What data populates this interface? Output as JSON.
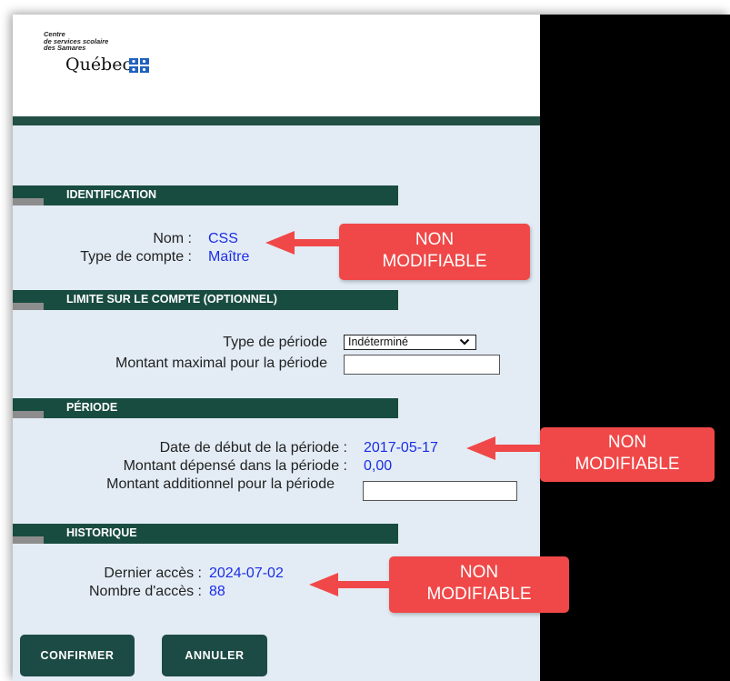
{
  "header": {
    "logo_line1": "Centre",
    "logo_line2": "de services scolaire",
    "logo_line3": "des Samares",
    "logo_word": "Québec"
  },
  "sections": {
    "identification": "IDENTIFICATION",
    "limite": "LIMITE SUR LE COMPTE (OPTIONNEL)",
    "periode": "PÉRIODE",
    "historique": "HISTORIQUE"
  },
  "identification": {
    "nom_label": "Nom :",
    "nom_value": "CSS",
    "type_label": "Type de compte :",
    "type_value": "Maître"
  },
  "limite": {
    "type_periode_label": "Type de période",
    "type_periode_selected": "Indéterminé",
    "montant_max_label": "Montant maximal pour la période",
    "montant_max_value": ""
  },
  "periode": {
    "date_debut_label": "Date de début de la période :",
    "date_debut_value": "2017-05-17",
    "montant_depense_label": "Montant dépensé dans la période :",
    "montant_depense_value": "0,00",
    "montant_add_label": "Montant additionnel pour la période",
    "montant_add_value": ""
  },
  "historique": {
    "dernier_acces_label": "Dernier accès :",
    "dernier_acces_value": "2024-07-02",
    "nombre_acces_label": "Nombre d'accès :",
    "nombre_acces_value": "88"
  },
  "buttons": {
    "confirmer": "CONFIRMER",
    "annuler": "ANNULER"
  },
  "callouts": {
    "line1": "NON",
    "line2": "MODIFIABLE"
  },
  "colors": {
    "section_bar": "#194c40",
    "value_text": "#1b2de8",
    "callout": "#f04848",
    "button": "#1c4a44",
    "panel": "#e3ecf5"
  }
}
